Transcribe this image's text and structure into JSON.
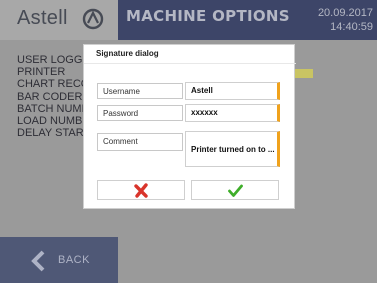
{
  "header": {
    "logo_text": "Astell",
    "title": "MACHINE OPTIONS",
    "date": "20.09.2017",
    "time": "14:40:59"
  },
  "options": [
    "USER LOGGING",
    "PRINTER",
    "CHART RECORDER",
    "BAR CODER",
    "BATCH NUMBER",
    "LOAD NUMBER",
    "DELAY START"
  ],
  "nav": {
    "back_label": "BACK"
  },
  "dialog": {
    "title": "Signature dialog",
    "username_label": "Username",
    "username_value": "Astell",
    "password_label": "Password",
    "password_value": "xxxxxx",
    "comment_label": "Comment",
    "comment_value": "Printer turned on to ..."
  },
  "colors": {
    "header_bar": "#3d4568",
    "back_button": "#4f5876",
    "field_accent": "#f0a21c",
    "cancel_icon": "#d9342b",
    "ok_icon": "#3fae2a"
  }
}
